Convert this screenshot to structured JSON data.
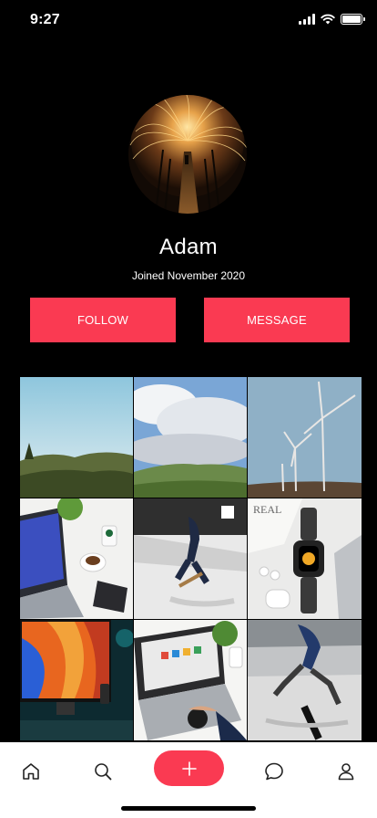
{
  "status_bar": {
    "time": "9:27",
    "icons": [
      "cellular-signal-icon",
      "wifi-icon",
      "battery-icon"
    ]
  },
  "profile": {
    "avatar_description": "steel wool sparks on boardwalk photo",
    "name": "Adam",
    "joined": "Joined November 2020"
  },
  "actions": {
    "follow_label": "FOLLOW",
    "message_label": "MESSAGE"
  },
  "colors": {
    "background": "#000000",
    "accent": "#fa3a52",
    "nav_background": "#ffffff"
  },
  "photo_grid": {
    "rows": 3,
    "columns": 3,
    "items": [
      "hills-under-blue-sky",
      "cloudy-sky-over-green-hills",
      "wind-turbines",
      "laptop-coffee-plants-desk",
      "skateboarder-skatepark",
      "smartwatch-airpods-laptop",
      "colorful-monitor-desk",
      "laptop-watch-workspace",
      "skateboarder-jumping"
    ]
  },
  "bottom_nav": {
    "items": [
      "home-icon",
      "search-icon",
      "add-icon",
      "chat-icon",
      "profile-icon"
    ]
  }
}
